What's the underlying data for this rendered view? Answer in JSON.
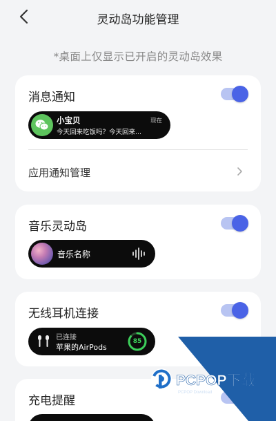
{
  "header": {
    "title": "灵动岛功能管理"
  },
  "subtitle": "*桌面上仅显示已开启的灵动岛效果",
  "cards": {
    "notification": {
      "title": "消息通知",
      "enabled": true,
      "preview": {
        "sender": "小宝贝",
        "time": "现在",
        "message": "今天回来吃饭吗？今天回来..."
      },
      "manage_label": "应用通知管理"
    },
    "music": {
      "title": "音乐灵动岛",
      "enabled": true,
      "preview": {
        "song": "音乐名称"
      }
    },
    "earphones": {
      "title": "无线耳机连接",
      "enabled": true,
      "preview": {
        "status": "已连接",
        "device": "苹果的AirPods",
        "battery": "85"
      }
    },
    "charging": {
      "title": "充电提醒",
      "enabled": true
    }
  },
  "watermark": {
    "brand": "PCPOP下载",
    "sub": "PCPOP Download"
  },
  "colors": {
    "accent": "#4a63e6",
    "toggle_track": "#b8c4f2",
    "wechat_green": "#5ec45e",
    "battery_green": "#3ccf5a",
    "watermark_blue": "#1f5fa8"
  }
}
